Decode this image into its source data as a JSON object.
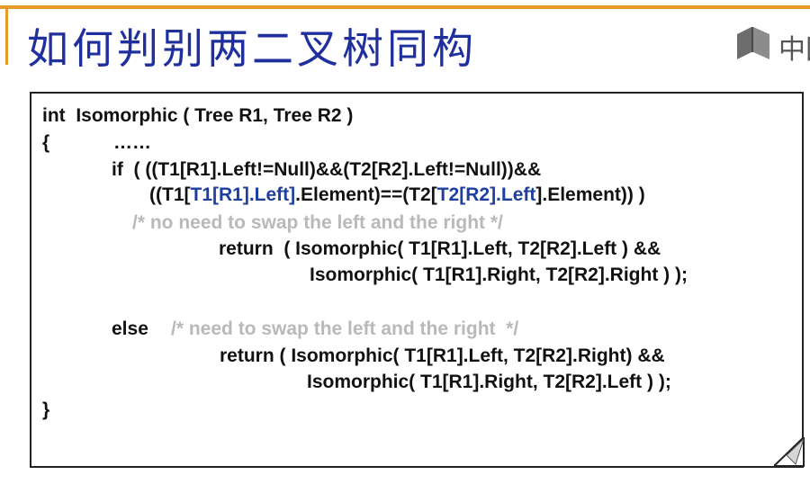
{
  "slide": {
    "title": "如何判别两二叉树同构",
    "logo_text": "中国",
    "accent_color": "#e59a2a",
    "title_color": "#1f2f9e",
    "highlight_color": "#1f3fa0",
    "comment_color": "#b9b9b9"
  },
  "code": {
    "line1": "int  Isomorphic ( Tree R1, Tree R2 )",
    "line2_brace": "{",
    "line2_dots": "……",
    "line3": "if  ( ((T1[R1].Left!=Null)&&(T2[R2].Left!=Null))&&",
    "line4_a": "((T1[",
    "line4_b": "T1[R1].Left]",
    "line4_c": ".Element)==(T2[",
    "line4_d": "T2[R2].Left",
    "line4_e": "].Element)) )",
    "comment1": "/* no need to swap the left and the right */",
    "line5": "return  ( Isomorphic( T1[R1].Left, T2[R2].Left ) &&",
    "line6": "Isomorphic( T1[R1].Right, T2[R2].Right ) );",
    "else_kw": "else",
    "comment2": "/* need to swap the left and the right  */",
    "line7": "return ( Isomorphic( T1[R1].Left, T2[R2].Right) &&",
    "line8": "Isomorphic( T1[R1].Right, T2[R2].Left ) );",
    "close_brace": "}"
  }
}
